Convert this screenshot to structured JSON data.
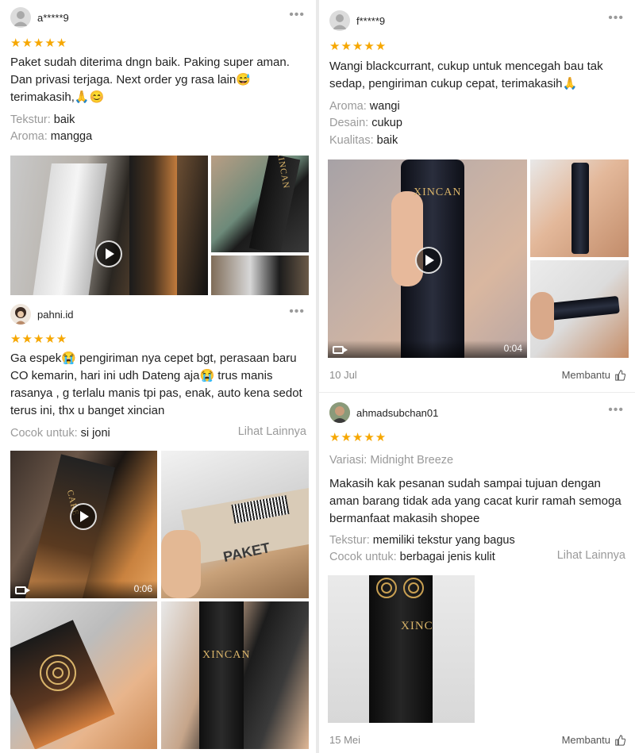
{
  "reviews": [
    {
      "user": "a*****9",
      "stars": "★★★★★",
      "text": "Paket sudah diterima dngn baik. Paking super aman. Dan privasi terjaga. Next order yg rasa lain😅 terimakasih,🙏😊",
      "attributes": [
        {
          "key": "Tekstur:",
          "value": "baik"
        },
        {
          "key": "Aroma:",
          "value": "mangga"
        }
      ],
      "media": [
        {
          "type": "video"
        },
        {
          "type": "image"
        },
        {
          "type": "image"
        }
      ]
    },
    {
      "user": "pahni.id",
      "stars": "★★★★★",
      "text": "Ga espek😭 pengiriman nya cepet bgt, perasaan baru CO kemarin, hari ini udh Dateng aja😭 trus manis rasanya , g terlalu manis tpi pas, enak, auto kena sedot terus ini, thx u banget xincian",
      "attributes": [
        {
          "key": "Cocok untuk:",
          "value": "si joni"
        }
      ],
      "more_label": "Lihat Lainnya",
      "media": [
        {
          "type": "video",
          "duration": "0:06"
        },
        {
          "type": "image",
          "label": "PAKET"
        },
        {
          "type": "image"
        },
        {
          "type": "image",
          "label": "XINCAN"
        }
      ]
    },
    {
      "user": "f*****9",
      "stars": "★★★★★",
      "text": "Wangi blackcurrant, cukup untuk mencegah bau tak sedap, pengiriman cukup cepat, terimakasih🙏",
      "attributes": [
        {
          "key": "Aroma:",
          "value": "wangi"
        },
        {
          "key": "Desain:",
          "value": "cukup"
        },
        {
          "key": "Kualitas:",
          "value": "baik"
        }
      ],
      "media": [
        {
          "type": "video",
          "duration": "0:04",
          "label": "XINCAN"
        },
        {
          "type": "image"
        },
        {
          "type": "image"
        }
      ],
      "date": "10 Jul",
      "helpful_label": "Membantu"
    },
    {
      "user": "ahmadsubchan01",
      "stars": "★★★★★",
      "variation_key": "Variasi:",
      "variation_value": "Midnight Breeze",
      "text": "Makasih kak pesanan sudah sampai tujuan dengan aman barang tidak ada yang cacat kurir ramah semoga bermanfaat makasih shopee",
      "attributes": [
        {
          "key": "Tekstur:",
          "value": "memiliki tekstur yang bagus"
        },
        {
          "key": "Cocok untuk:",
          "value": "berbagai jenis kulit"
        }
      ],
      "more_label": "Lihat Lainnya",
      "media": [
        {
          "type": "image",
          "label": "XINC"
        }
      ],
      "date": "15 Mei",
      "helpful_label": "Membantu"
    }
  ],
  "colors": {
    "star": "#f6a700",
    "muted": "#9a9a9a",
    "text": "#222222"
  },
  "icons": [
    "more-icon",
    "play-icon",
    "video-camera-icon",
    "thumbs-up-icon",
    "user-avatar-icon"
  ]
}
